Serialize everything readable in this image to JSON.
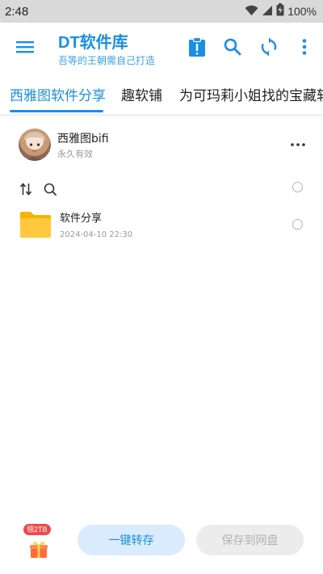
{
  "status_bar": {
    "time": "2:48",
    "battery_text": "100%",
    "icons": [
      "wifi-icon",
      "signal-icon",
      "battery-icon"
    ]
  },
  "app_bar": {
    "title": "DT软件库",
    "subtitle": "吾等的王朝需自己打造",
    "icons": [
      "menu-icon",
      "clipboard-alert-icon",
      "search-icon",
      "refresh-icon",
      "more-vert-icon"
    ],
    "accent_color": "#1a8fe3"
  },
  "tabs": [
    {
      "label": "西雅图软件分享",
      "active": true
    },
    {
      "label": "趣软铺",
      "active": false
    },
    {
      "label": "为可玛莉小姐找的宝藏软",
      "active": false
    }
  ],
  "share": {
    "owner_name": "西雅图bifi",
    "expiry": "永久有效"
  },
  "files": [
    {
      "name": "软件分享",
      "date": "2024-04-10 22:30",
      "icon": "folder-icon"
    }
  ],
  "bottom": {
    "gift_badge": "领2TB",
    "save_button": "一键转存",
    "save_to_disk_button": "保存到网盘"
  }
}
